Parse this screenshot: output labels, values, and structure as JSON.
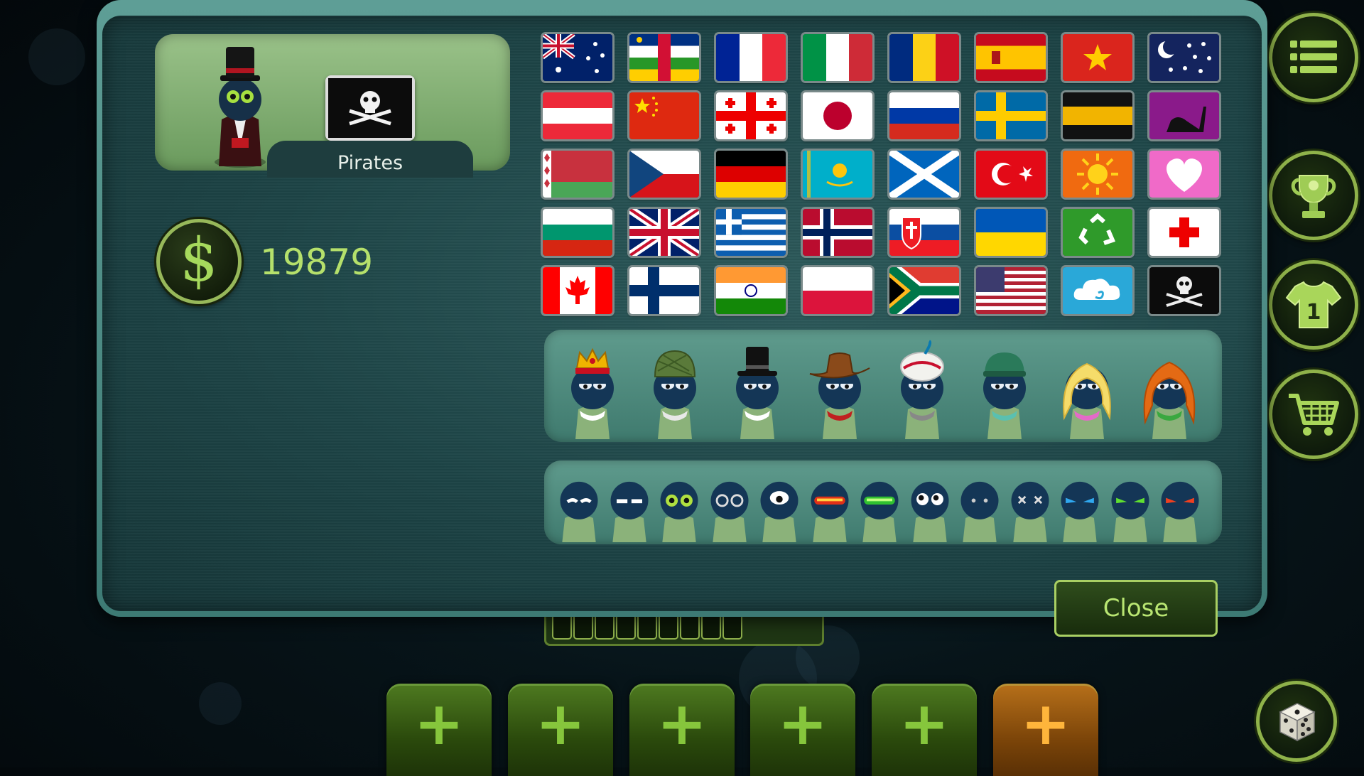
{
  "profile": {
    "team_name": "Pirates",
    "flag_icon": "pirate-flag-icon",
    "avatar_icon": "top-hat-pawn-icon"
  },
  "wallet": {
    "currency_symbol": "$",
    "amount": "19879"
  },
  "flags": [
    [
      "australia",
      "central-african-republic",
      "france",
      "italy",
      "romania",
      "spain",
      "vietnam",
      "night-sky"
    ],
    [
      "austria",
      "china",
      "georgia",
      "japan",
      "russia",
      "sweden",
      "black-yellow",
      "high-heel"
    ],
    [
      "belarus",
      "czech-republic",
      "germany",
      "kazakhstan",
      "scotland",
      "turkey",
      "sun",
      "heart"
    ],
    [
      "bulgaria",
      "united-kingdom",
      "greece",
      "norway",
      "slovakia",
      "ukraine",
      "recycle",
      "red-cross"
    ],
    [
      "canada",
      "finland",
      "india",
      "poland",
      "south-africa",
      "united-states",
      "cloud",
      "pirate"
    ]
  ],
  "hats": [
    "crown",
    "army-helmet",
    "top-hat",
    "cowboy-hat",
    "turban",
    "beanie",
    "blonde-hair",
    "red-hair"
  ],
  "eye_styles": [
    "sleepy",
    "squint",
    "green-eyes",
    "hollow",
    "cyclops",
    "red-visor",
    "green-visor",
    "wide",
    "dots",
    "crossed",
    "blue-angry",
    "green-angry",
    "red-angry"
  ],
  "actions": {
    "close_label": "Close",
    "plus_label": "+"
  },
  "side_buttons": [
    "menu-icon",
    "trophy-icon",
    "jersey-icon",
    "cart-icon"
  ],
  "progress_slots": 9,
  "colors": {
    "accent_green": "#b5e06b",
    "panel_teal": "#2d5a5b",
    "orange": "#ffb53b"
  }
}
